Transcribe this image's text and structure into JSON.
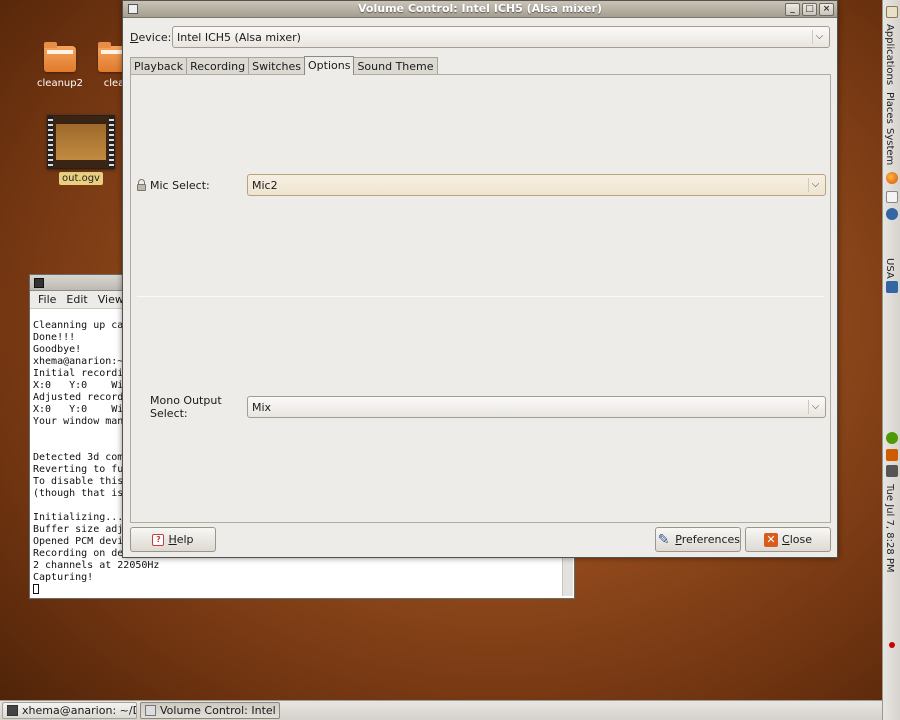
{
  "desktop": {
    "icons": [
      {
        "label": "cleanup2"
      },
      {
        "label": "clea"
      },
      {
        "label": "out.ogv"
      }
    ]
  },
  "terminal": {
    "menu": [
      "File",
      "Edit",
      "View"
    ],
    "lines": [
      "Cleanning up cac",
      "Done!!!",
      "Goodbye!",
      "xhema@anarion:~/",
      "Initial recordin",
      "X:0   Y:0    Wid",
      "Adjusted recordi",
      "X:0   Y:0    Wid",
      "Your window mana",
      "",
      "",
      "Detected 3d comp",
      "Reverting to ful",
      "To disable this ",
      "(though that is ",
      "",
      "Initializing...",
      "Buffer size adju",
      "Opened PCM devic",
      "Recording on dev",
      "2 channels at 22050Hz",
      "Capturing!"
    ]
  },
  "window": {
    "title": "Volume Control: Intel ICH5 (Alsa mixer)",
    "controls": {
      "minimize": "_",
      "maximize": "□",
      "close": "×"
    },
    "device_label_u": "D",
    "device_label_rest": "evice:",
    "device_value": "Intel ICH5 (Alsa mixer)",
    "tabs": [
      {
        "label": "Playback"
      },
      {
        "label": "Recording"
      },
      {
        "label": "Switches"
      },
      {
        "label": "Options"
      },
      {
        "label": "Sound Theme"
      }
    ],
    "options": {
      "mic_label": "Mic Select:",
      "mic_value": "Mic2",
      "mono_label": "Mono Output Select:",
      "mono_value": "Mix"
    },
    "buttons": {
      "help_u": "H",
      "help_rest": "elp",
      "preferences_u": "P",
      "preferences_rest": "references",
      "close_u": "C",
      "close_rest": "lose"
    }
  },
  "right_panel": {
    "applications": "Applications",
    "places": "Places",
    "system": "System",
    "keyboard": "USA",
    "clock": "Tue Jul  7,  8:28 PM"
  },
  "taskbar": {
    "items": [
      {
        "label": "xhema@anarion: ~/De..."
      },
      {
        "label": "Volume Control: Intel I..."
      }
    ]
  }
}
